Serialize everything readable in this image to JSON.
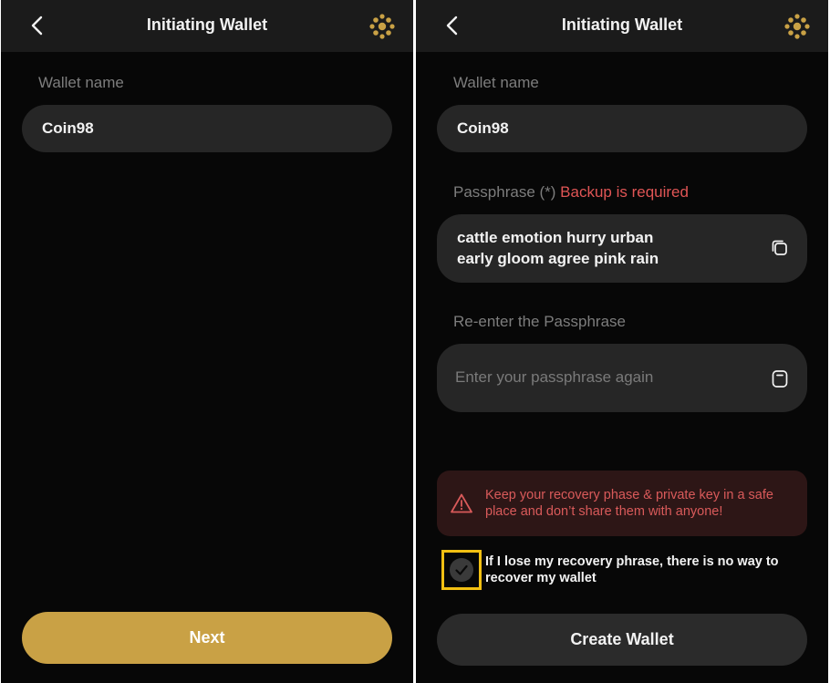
{
  "left_screen": {
    "header": {
      "title": "Initiating Wallet",
      "back_icon": "chevron-left-icon",
      "brand_icon": "coin98-logo-icon"
    },
    "wallet_name": {
      "label": "Wallet name",
      "value": "Coin98"
    },
    "next_button": {
      "label": "Next"
    }
  },
  "right_screen": {
    "header": {
      "title": "Initiating Wallet",
      "back_icon": "chevron-left-icon",
      "brand_icon": "coin98-logo-icon"
    },
    "wallet_name": {
      "label": "Wallet name",
      "value": "Coin98"
    },
    "passphrase": {
      "label": "Passphrase (*)",
      "warning": "Backup is required",
      "line1": "cattle emotion hurry urban",
      "line2": "early gloom agree pink rain",
      "icon": "copy-icon"
    },
    "reenter": {
      "label": "Re-enter the Passphrase",
      "placeholder": "Enter your passphrase again",
      "value": "",
      "icon": "paste-clipboard-icon"
    },
    "alert": {
      "icon": "warning-triangle-icon",
      "text": "Keep your recovery phase & private key in a safe place and don’t share them with anyone!"
    },
    "confirm": {
      "checked": true,
      "text": "If I lose my recovery phrase, there is no way to recover my wallet"
    },
    "create_button": {
      "label": "Create Wallet"
    }
  },
  "colors": {
    "background": "#070707",
    "header": "#1b1b1b",
    "field": "#262626",
    "accent_gold": "#c9a145",
    "warning_red": "#e05555",
    "highlight_yellow": "#f2c012"
  }
}
